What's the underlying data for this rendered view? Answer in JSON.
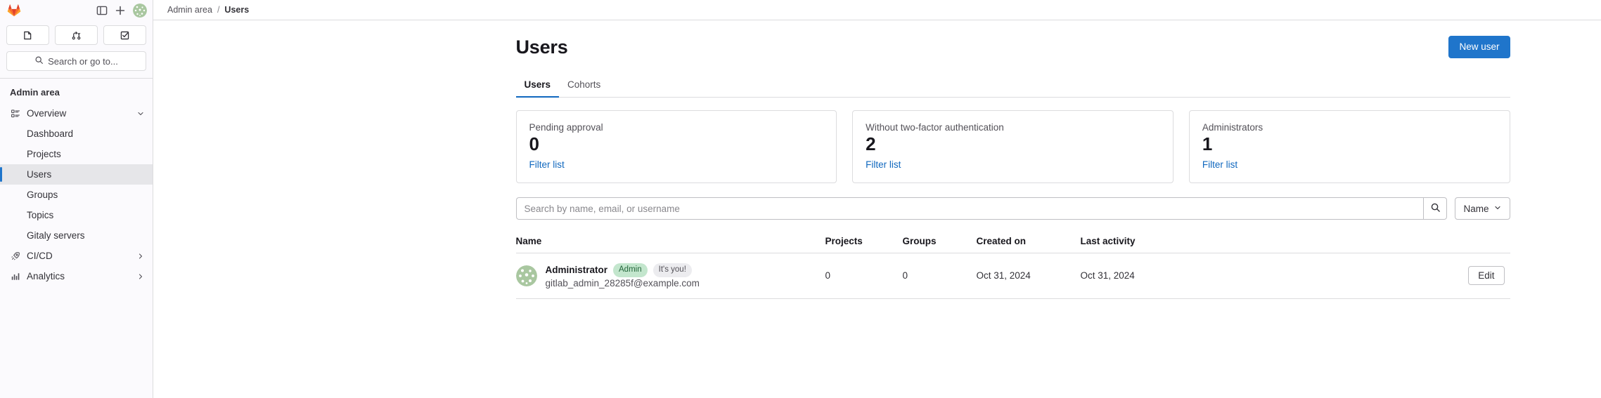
{
  "sidebar": {
    "logo_icon": "gitlab-logo-icon",
    "panel_toggle_icon": "sidebar-toggle-icon",
    "new_icon": "plus-icon",
    "avatar_icon": "user-avatar",
    "quick_links": [
      {
        "name": "issues",
        "icon": "issue-icon"
      },
      {
        "name": "merge-requests",
        "icon": "merge-request-icon"
      },
      {
        "name": "todos",
        "icon": "todo-check-icon"
      }
    ],
    "search_placeholder": "Search or go to...",
    "search_icon": "search-icon",
    "heading": "Admin area",
    "items": [
      {
        "label": "Overview",
        "icon": "overview-icon",
        "chevron": "chevron-down-icon",
        "active": false
      },
      {
        "label": "Dashboard",
        "icon": "",
        "chevron": "",
        "active": false
      },
      {
        "label": "Projects",
        "icon": "",
        "chevron": "",
        "active": false
      },
      {
        "label": "Users",
        "icon": "",
        "chevron": "",
        "active": true
      },
      {
        "label": "Groups",
        "icon": "",
        "chevron": "",
        "active": false
      },
      {
        "label": "Topics",
        "icon": "",
        "chevron": "",
        "active": false
      },
      {
        "label": "Gitaly servers",
        "icon": "",
        "chevron": "",
        "active": false
      },
      {
        "label": "CI/CD",
        "icon": "rocket-icon",
        "chevron": "chevron-right-icon",
        "active": false
      },
      {
        "label": "Analytics",
        "icon": "analytics-icon",
        "chevron": "chevron-right-icon",
        "active": false
      }
    ]
  },
  "breadcrumb": {
    "parent": "Admin area",
    "separator": "/",
    "current": "Users"
  },
  "page": {
    "title": "Users",
    "new_user_label": "New user"
  },
  "tabs": [
    {
      "label": "Users",
      "active": true
    },
    {
      "label": "Cohorts",
      "active": false
    }
  ],
  "cards": [
    {
      "title": "Pending approval",
      "value": "0",
      "link": "Filter list"
    },
    {
      "title": "Without two-factor authentication",
      "value": "2",
      "link": "Filter list"
    },
    {
      "title": "Administrators",
      "value": "1",
      "link": "Filter list"
    }
  ],
  "search": {
    "placeholder": "Search by name, email, or username",
    "value": "",
    "submit_icon": "search-icon",
    "sort_label": "Name",
    "sort_chevron": "chevron-down-icon"
  },
  "table": {
    "columns": [
      "Name",
      "Projects",
      "Groups",
      "Created on",
      "Last activity",
      ""
    ],
    "rows": [
      {
        "name": "Administrator",
        "badge_admin": "Admin",
        "badge_you": "It's you!",
        "email": "gitlab_admin_28285f@example.com",
        "projects": "0",
        "groups": "0",
        "created_on": "Oct 31, 2024",
        "last_activity": "Oct 31, 2024",
        "edit_label": "Edit"
      }
    ]
  },
  "colors": {
    "accent_blue": "#1f75cb",
    "link_blue": "#1068bf",
    "badge_admin_bg": "#c3e6cd",
    "badge_admin_text": "#24663b",
    "active_item_bg": "#e6e6e9",
    "border": "#dcdcde"
  }
}
